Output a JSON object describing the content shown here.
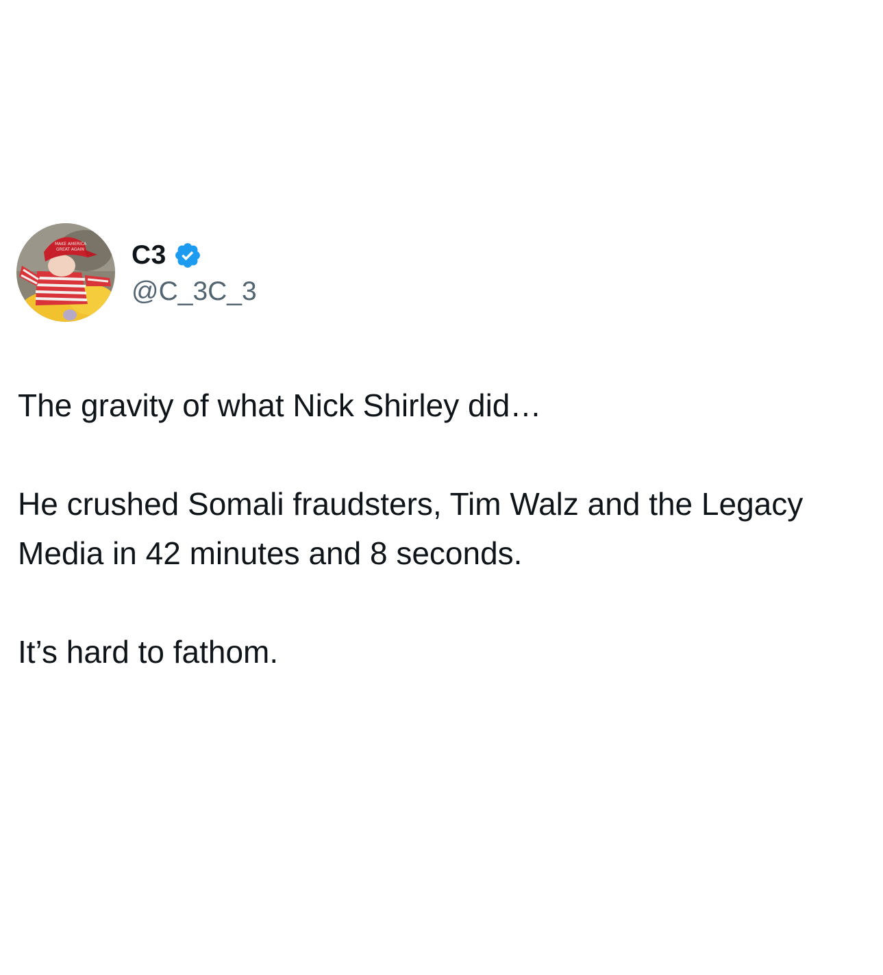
{
  "author": {
    "display_name": "C3",
    "handle": "@C_3C_3",
    "verified": true,
    "avatar_icon": "profile-photo-child-in-red-cap-icon",
    "verified_icon": "verified-badge-icon",
    "verified_color": "#1d9bf0"
  },
  "tweet": {
    "paragraphs": [
      "The gravity of what Nick Shirley did…",
      "He crushed Somali fraudsters, Tim Walz and the Legacy Media in 42 minutes and 8 seconds.",
      "It’s hard to fathom."
    ]
  },
  "colors": {
    "text": "#0f1419",
    "secondary_text": "#536471",
    "background": "#ffffff"
  }
}
